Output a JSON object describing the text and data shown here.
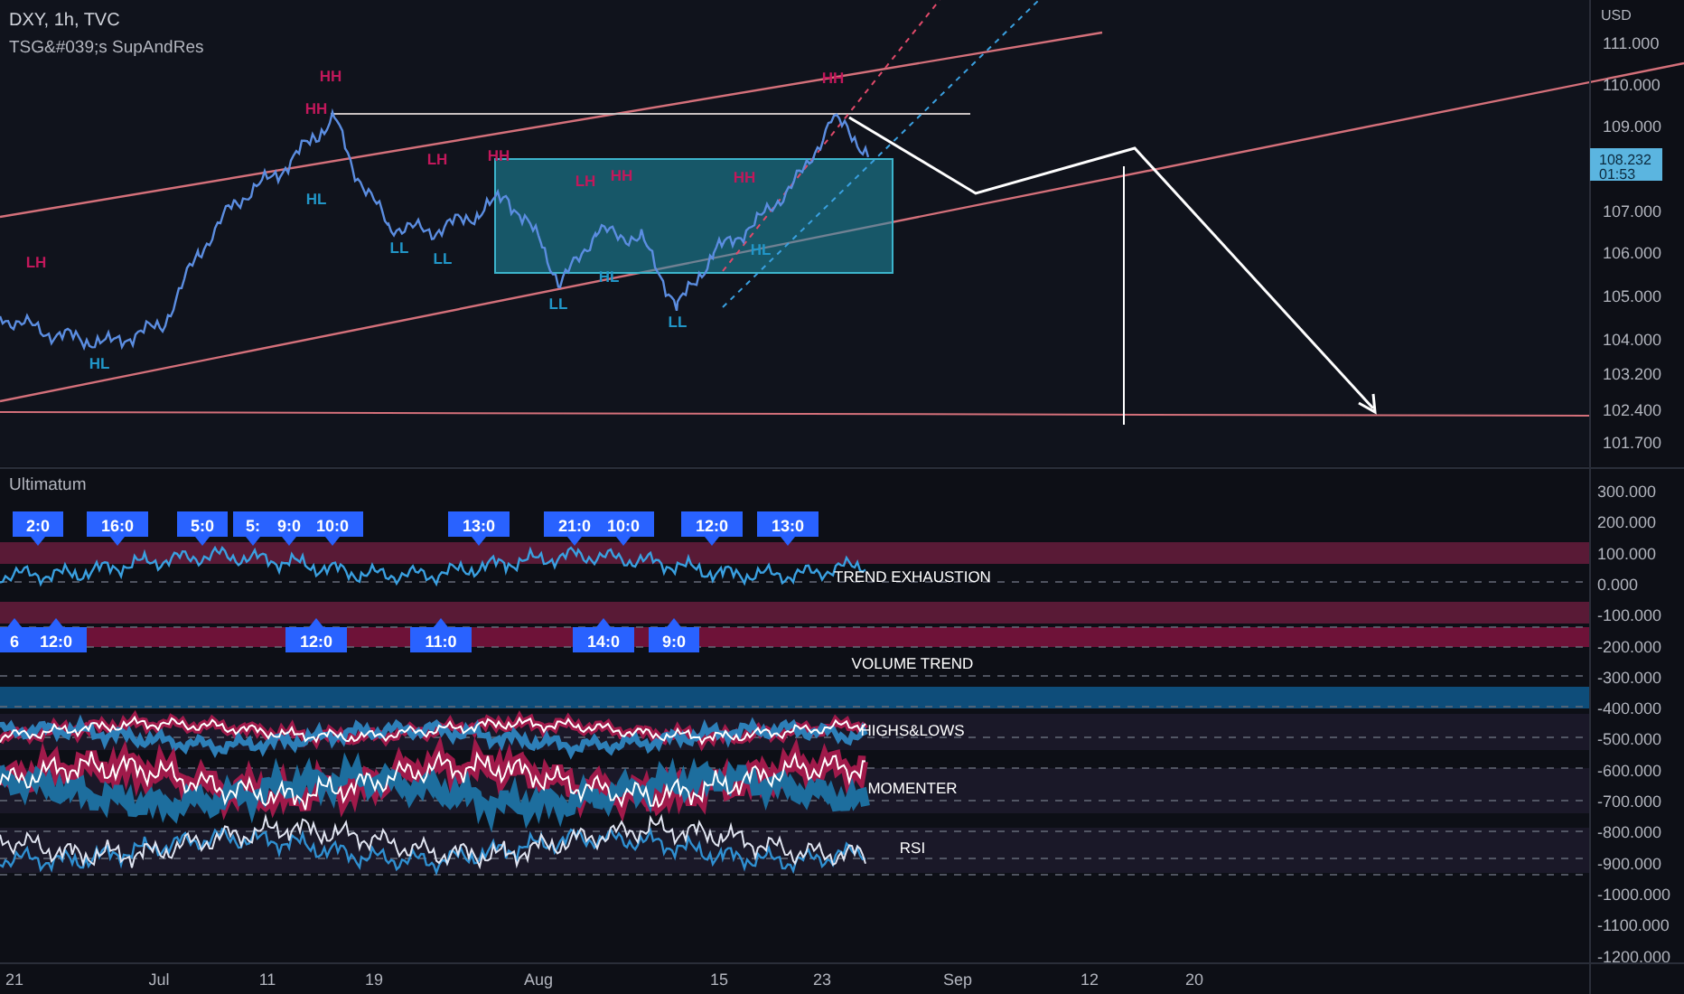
{
  "header": {
    "symbol": "DXY, 1h, TVC",
    "indicator": "TSG&#039;s SupAndRes"
  },
  "price_axis": {
    "unit": "USD",
    "ticks": [
      "111.000",
      "110.000",
      "109.000",
      "107.000",
      "106.000",
      "105.000",
      "104.000",
      "103.200",
      "102.400",
      "101.700"
    ],
    "last_price": {
      "value": "108.232",
      "countdown": "01:53"
    }
  },
  "pattern_labels": [
    {
      "text": "HH",
      "kind": "high"
    },
    {
      "text": "HH",
      "kind": "high"
    },
    {
      "text": "LH",
      "kind": "high"
    },
    {
      "text": "LH",
      "kind": "high"
    },
    {
      "text": "HH",
      "kind": "high"
    },
    {
      "text": "LH",
      "kind": "high"
    },
    {
      "text": "HH",
      "kind": "high"
    },
    {
      "text": "HH",
      "kind": "high"
    },
    {
      "text": "HH",
      "kind": "high"
    },
    {
      "text": "HL",
      "kind": "low"
    },
    {
      "text": "LL",
      "kind": "low"
    },
    {
      "text": "LL",
      "kind": "low"
    },
    {
      "text": "LL",
      "kind": "low"
    },
    {
      "text": "HL",
      "kind": "low"
    },
    {
      "text": "LL",
      "kind": "low"
    },
    {
      "text": "HL",
      "kind": "low"
    },
    {
      "text": "HL",
      "kind": "low"
    }
  ],
  "oscillator_pane": {
    "title": "Ultimatum",
    "top_callouts": [
      "2:0",
      "16:0",
      "5:0",
      "5:",
      "9:0",
      "10:0",
      "13:0",
      "21:0",
      "10:0",
      "12:0",
      "13:0"
    ],
    "bottom_callouts": [
      "6",
      "12:0",
      "12:0",
      "11:0",
      "14:0",
      "9:0"
    ],
    "section_labels": [
      "TREND EXHAUSTION",
      "VOLUME TREND",
      "HIGHS&LOWS",
      "MOMENTER",
      "RSI"
    ],
    "axis_ticks": [
      "300.000",
      "200.000",
      "100.000",
      "0.000",
      "-100.000",
      "-200.000",
      "-300.000",
      "-400.000",
      "-500.000",
      "-600.000",
      "-700.000",
      "-800.000",
      "-900.000",
      "-1000.000",
      "-1100.000",
      "-1200.000"
    ]
  },
  "time_axis": [
    "21",
    "Jul",
    "11",
    "19",
    "Aug",
    "15",
    "23",
    "Sep",
    "12",
    "20"
  ]
}
